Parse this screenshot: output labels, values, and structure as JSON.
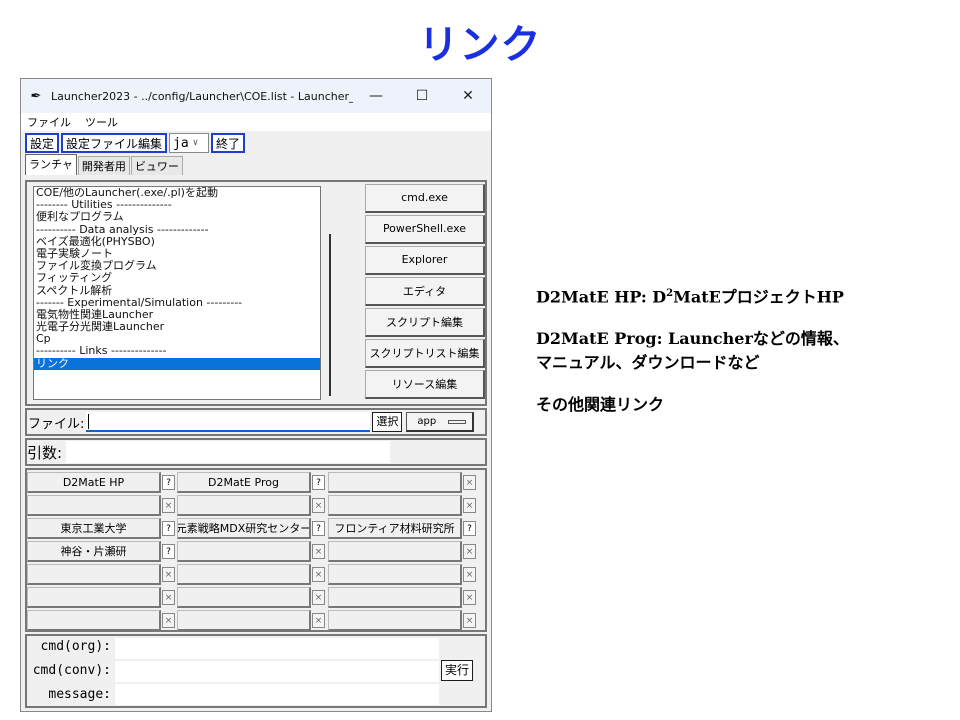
{
  "slide": {
    "title": "リンク",
    "title_color": "#1a2fe0",
    "notes": {
      "hp_prefix": "D2MatE HP: D",
      "hp_sup": "2",
      "hp_suffix": "MatEプロジェクトHP",
      "prog_line1": "D2MatE Prog: Launcherなどの情報、",
      "prog_line2": "マニュアル、ダウンロードなど",
      "other": "その他関連リンク"
    }
  },
  "window": {
    "title": "Launcher2023 - ../config/Launcher\\COE.list - Launcher_...",
    "app_icon": "feather-icon",
    "controls": {
      "minimize": "—",
      "maximize": "☐",
      "close": "✕"
    },
    "menu": [
      "ファイル",
      "ツール"
    ],
    "toolbar": {
      "settings": "設定",
      "edit_settings_file": "設定ファイル編集",
      "language": "ja",
      "quit": "終了"
    },
    "tabs": [
      "ランチャ",
      "開発者用",
      "ビュワー"
    ],
    "list_items": [
      "COE/他のLauncher(.exe/.pl)を起動",
      "-------- Utilities --------------",
      "便利なプログラム",
      "---------- Data analysis -------------",
      "ベイズ最適化(PHYSBO)",
      "電子実験ノート",
      "ファイル変換プログラム",
      "フィッティング",
      "スペクトル解析",
      "------- Experimental/Simulation ---------",
      "電気物性関連Launcher",
      "光電子分光関連Launcher",
      "Cp",
      "---------- Links --------------",
      "リンク"
    ],
    "selected_index": 14,
    "side_buttons": [
      "cmd.exe",
      "PowerShell.exe",
      "Explorer",
      "エディタ",
      "スクリプト編集",
      "スクリプトリスト編集",
      "リソース編集"
    ],
    "file": {
      "label": "ファイル:",
      "value": "",
      "select_button": "選択",
      "app_menu": "app"
    },
    "args": {
      "label": "引数:",
      "value": ""
    },
    "links_grid": {
      "rows": [
        [
          "D2MatE HP",
          "D2MatE Prog",
          ""
        ],
        [
          "",
          "",
          ""
        ],
        [
          "東京工業大学",
          "元素戦略MDX研究センター",
          "フロンティア材料研究所"
        ],
        [
          "神谷・片瀬研",
          "",
          ""
        ],
        [
          "",
          "",
          ""
        ],
        [
          "",
          "",
          ""
        ],
        [
          "",
          "",
          ""
        ]
      ],
      "help_glyph": "?",
      "clear_glyph": "×"
    },
    "cmd": {
      "org_label": "cmd(org):",
      "conv_label": "cmd(conv):",
      "message_label": "message:",
      "org_value": "",
      "conv_value": "",
      "message_value": "",
      "run_button": "実行"
    }
  }
}
